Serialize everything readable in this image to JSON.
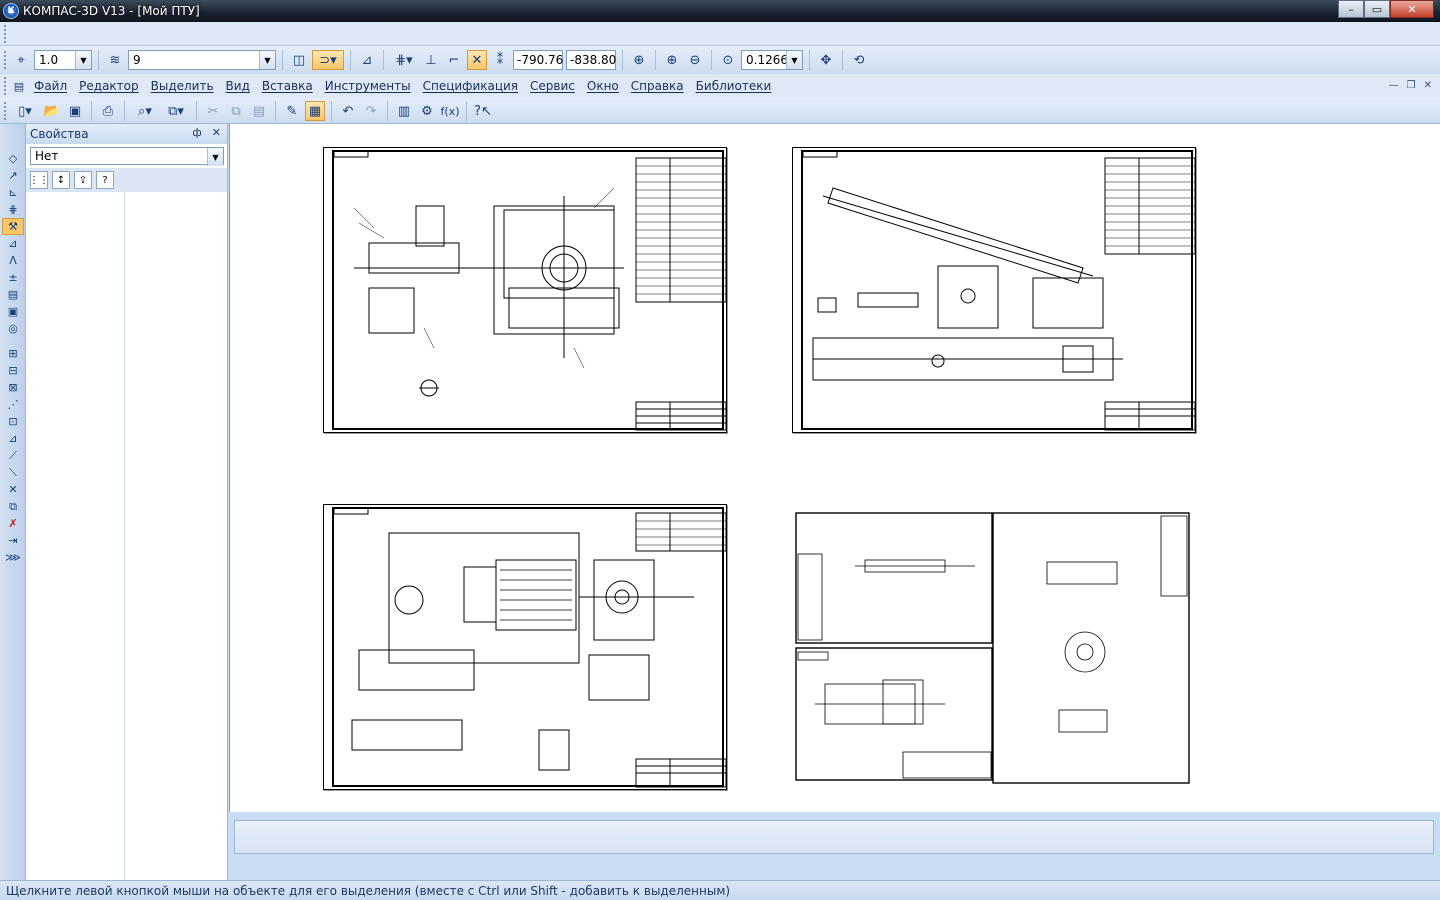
{
  "window": {
    "title": "КОМПАС-3D V13 - [Мой ПТУ]",
    "app_icon_letter": "K",
    "buttons": [
      "–",
      "▭",
      "✕"
    ]
  },
  "toolbar_current": {
    "step": "1.0",
    "layer": "9",
    "coord_x": "-790.76",
    "coord_y": "-838.80",
    "zoom": "0.1266"
  },
  "menu": [
    "Файл",
    "Редактор",
    "Выделить",
    "Вид",
    "Вставка",
    "Инструменты",
    "Спецификация",
    "Сервис",
    "Окно",
    "Справка",
    "Библиотеки"
  ],
  "properties": {
    "title": "Свойства",
    "pin": "ф",
    "close": "✕",
    "selector_value": "Нет"
  },
  "status_text": "Щелкните левой кнопкой мыши на объекте для его выделения (вместе с Ctrl или Shift - добавить к выделенным)",
  "icons": {
    "accent": "#f8c76a",
    "chrome": "#c9dcf3"
  }
}
